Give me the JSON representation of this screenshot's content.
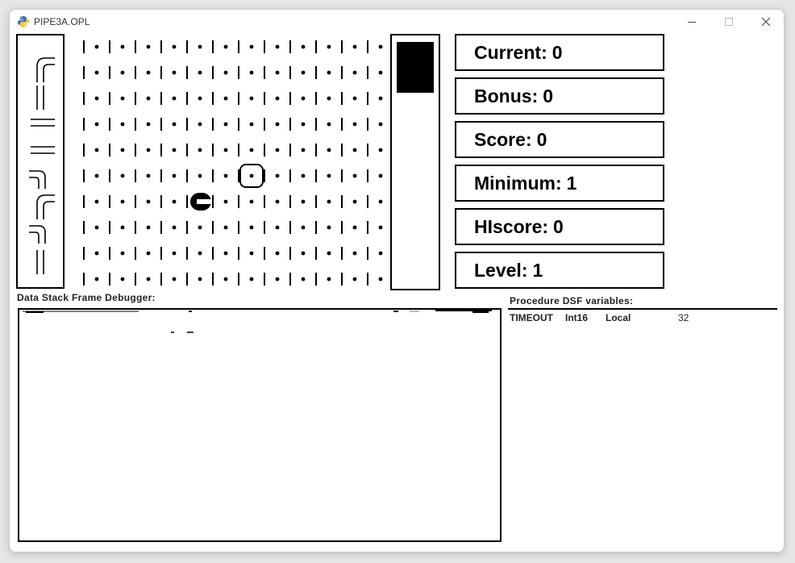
{
  "window": {
    "title": "PIPE3A.OPL",
    "icon": "python-icon"
  },
  "board": {
    "columns": 12,
    "rows": 10,
    "start_cell": {
      "col": 4,
      "row": 6
    },
    "current_cell": {
      "col": 6,
      "row": 5
    }
  },
  "pieces_queue": [
    "elbow-down-right",
    "vertical",
    "horizontal",
    "horizontal",
    "elbow-left-down",
    "elbow-down-right",
    "elbow-left-down",
    "vertical"
  ],
  "timer": {
    "remaining_fraction": 0.21
  },
  "stats": [
    {
      "label": "Current",
      "value": "0"
    },
    {
      "label": "Bonus",
      "value": "0"
    },
    {
      "label": "Score",
      "value": "0"
    },
    {
      "label": "Minimum",
      "value": "1"
    },
    {
      "label": "HIscore",
      "value": "0"
    },
    {
      "label": "Level",
      "value": "1"
    }
  ],
  "debugger": {
    "label": "Data Stack Frame Debugger:"
  },
  "procedure": {
    "label": "Procedure DSF variables:",
    "variables": [
      {
        "name": "TIMEOUT",
        "type": "Int16",
        "scope": "Local",
        "value": "32"
      }
    ]
  }
}
